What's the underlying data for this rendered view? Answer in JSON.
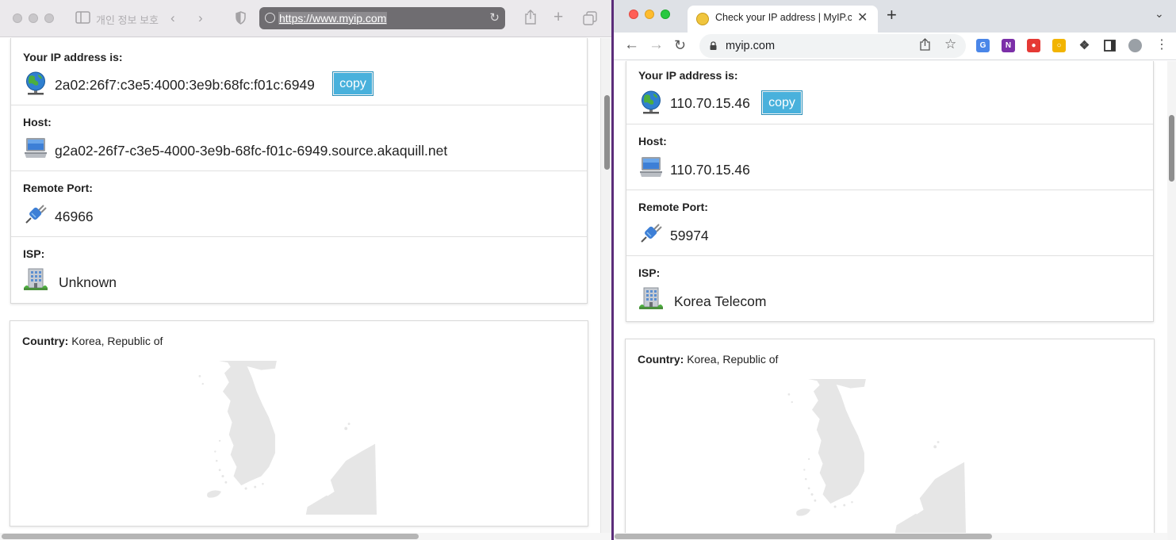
{
  "left_window": {
    "privacy_label": "개인 정보 보호",
    "url": "https://www.myip.com",
    "ip_label": "Your IP address is:",
    "ip_value": "2a02:26f7:c3e5:4000:3e9b:68fc:f01c:6949",
    "copy_label": "copy",
    "host_label": "Host:",
    "host_value": "g2a02-26f7-c3e5-4000-3e9b-68fc-f01c-6949.source.akaquill.net",
    "port_label": "Remote Port:",
    "port_value": "46966",
    "isp_label": "ISP:",
    "isp_value": "Unknown",
    "country_label": "Country:",
    "country_value": "Korea, Republic of"
  },
  "right_window": {
    "tab_title": "Check your IP address | MyIP.com",
    "omnibox_text": "myip.com",
    "ip_label": "Your IP address is:",
    "ip_value": "110.70.15.46",
    "copy_label": "copy",
    "host_label": "Host:",
    "host_value": "110.70.15.46",
    "port_label": "Remote Port:",
    "port_value": "59974",
    "isp_label": "ISP:",
    "isp_value": "Korea Telecom",
    "country_label": "Country:",
    "country_value": "Korea, Republic of"
  },
  "colors": {
    "copy_button": "#49b1dc",
    "divider": "#5b2d7a",
    "map_fill": "#e6e6e6"
  },
  "icons": {
    "ip": "globe-icon",
    "host": "computer-icon",
    "port": "plug-icon",
    "isp": "building-icon"
  }
}
